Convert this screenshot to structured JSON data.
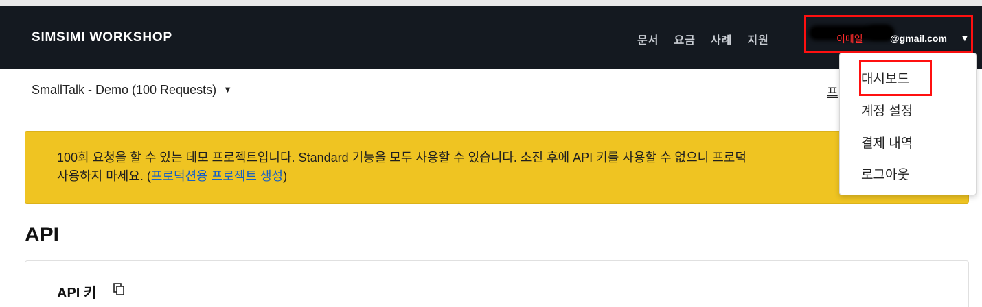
{
  "header": {
    "brand": "SIMSIMI WORKSHOP",
    "nav": [
      "문서",
      "요금",
      "사례",
      "지원"
    ],
    "account": {
      "email_hint": "이메일",
      "email_domain": "@gmail.com",
      "caret": "▼"
    }
  },
  "subheader": {
    "project_name": "SmallTalk - Demo (100 Requests)",
    "project_caret": "▼",
    "right_link": "프"
  },
  "notice": {
    "text_line1": "100회 요청을 할 수 있는 데모 프로젝트입니다. Standard 기능을 모두 사용할 수 있습니다. 소진 후에 API 키를 사용할 수 없으니 프로덕",
    "text_line2_prefix": "사용하지 마세요. (",
    "link_text": "프로덕션용 프로젝트 생성",
    "text_line2_suffix": ")"
  },
  "api_section": {
    "title": "API",
    "key_label": "API 키"
  },
  "account_menu": {
    "items": [
      "대시보드",
      "계정 설정",
      "결제 내역",
      "로그아웃"
    ]
  },
  "colors": {
    "topbar": "#141920",
    "notice_bg": "#efc422",
    "link": "#1760c2",
    "highlight": "#ff1010"
  },
  "icons": [
    "copy-icon",
    "caret-down-icon"
  ]
}
